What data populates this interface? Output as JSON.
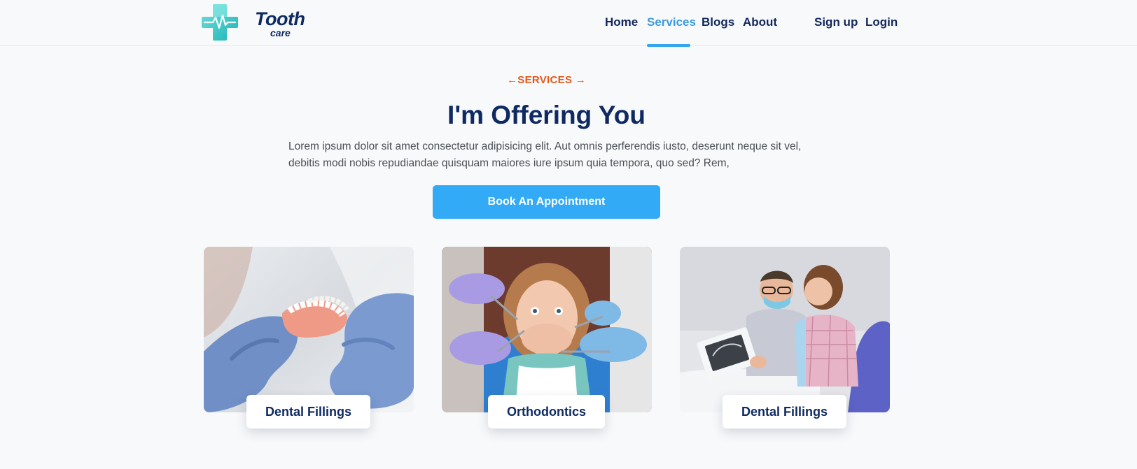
{
  "brand": {
    "name_line1": "Tooth",
    "name_line2": "care",
    "accent_color": "#2fc6c3",
    "brand_color": "#0f2a63"
  },
  "nav": {
    "items": [
      {
        "label": "Home",
        "active": false
      },
      {
        "label": "Services",
        "active": true
      },
      {
        "label": "Blogs",
        "active": false
      },
      {
        "label": "About",
        "active": false
      }
    ],
    "signup": "Sign up",
    "login": "Login",
    "active_color": "#3a9be0"
  },
  "hero": {
    "eyebrow": "←SERVICES →",
    "title": "I'm Offering You",
    "description": "Lorem ipsum dolor sit amet consectetur adipisicing elit. Aut omnis perferendis iusto, deserunt neque sit vel, debitis modi nobis repudiandae quisquam maiores iure ipsum quia tempora, quo sed? Rem,",
    "cta_label": "Book An Appointment",
    "cta_color": "#32aaf5",
    "eyebrow_color": "#e4571d"
  },
  "services": [
    {
      "title": "Dental Fillings",
      "image": "denture-model-gloved-hands-photo"
    },
    {
      "title": "Orthodontics",
      "image": "patient-covering-mouth-with-dentists-photo"
    },
    {
      "title": "Dental Fillings",
      "image": "dentist-showing-xray-to-patient-photo"
    }
  ]
}
